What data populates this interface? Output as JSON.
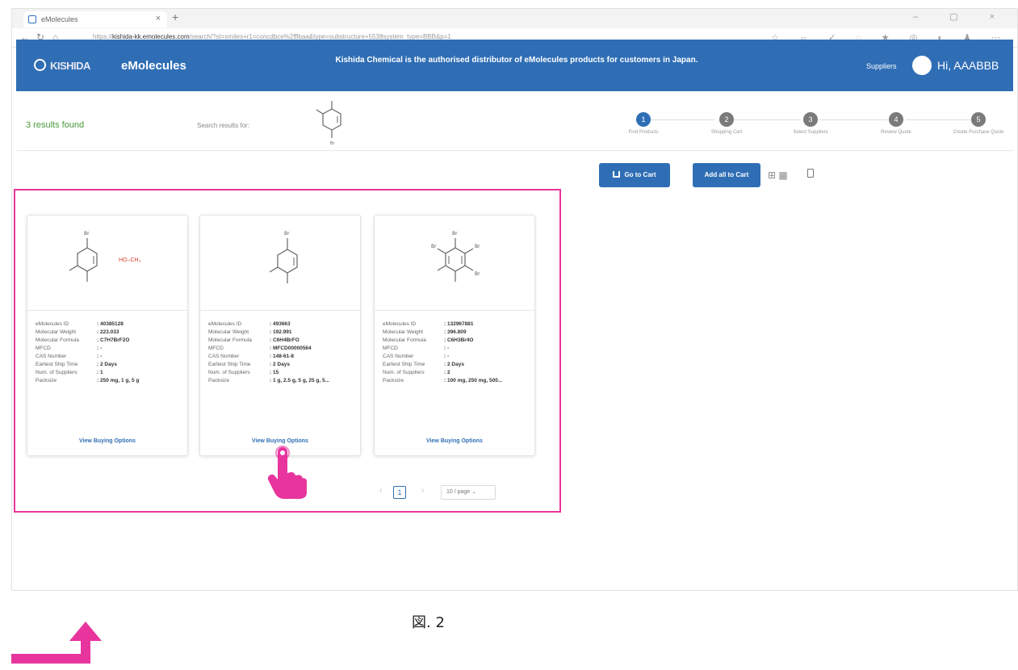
{
  "browser": {
    "tab_title": "eMolecules",
    "tab_close": "×",
    "new_tab": "+",
    "window_controls": "– ▢ ×",
    "nav": {
      "back": "←",
      "refresh": "↻",
      "home": "⌂"
    },
    "url_prefix": "https://",
    "url_host": "kishida-kk.emolecules.com",
    "url_path": "/search/?st=smiles+r1=concdbce%2fflbaa&type=substructure+5538system_type=BBB&p=1",
    "toolbar_icons": "☆ ⇔ ✓ ◌ ★ ◎ ◐ ♟ ⋯"
  },
  "header": {
    "logo_text": "KISHIDA",
    "brand": "eMolecules",
    "banner": "Kishida Chemical is the authorised distributor of eMolecules products for customers in Japan.",
    "suppliers_link": "Suppliers",
    "greeting": "Hi, AAABBB"
  },
  "summary": {
    "results_found": "3 results found",
    "search_label": "Search results for:"
  },
  "stepper": [
    {
      "number": "1",
      "label": "Find Products",
      "active": true
    },
    {
      "number": "2",
      "label": "Shopping Cart",
      "active": false
    },
    {
      "number": "3",
      "label": "Select Suppliers",
      "active": false
    },
    {
      "number": "4",
      "label": "Review Quote",
      "active": false
    },
    {
      "number": "5",
      "label": "Create Purchase Quote",
      "active": false
    }
  ],
  "toolbar": {
    "go_to_cart": "Go to Cart",
    "add_all_to_cart": "Add all to Cart",
    "grid_view": "⊞ ▦"
  },
  "spec_labels": [
    "eMolecules ID",
    "Molecular Weight",
    "Molecular Formula",
    "MFCD",
    "CAS Number",
    "Earliest Ship Time",
    "Num. of Suppliers",
    "Packsize"
  ],
  "cards": [
    {
      "values": [
        ": 40385128",
        ": 223.033",
        ": C7H7BrF2O",
        ": -",
        ": -",
        ": 2 Days",
        ": 1",
        ": 250 mg, 1 g, 5 g"
      ],
      "view_options": "View Buying Options",
      "image_label": "HO–CH₃"
    },
    {
      "values": [
        ": 493663",
        ": 192.991",
        ": C6H4BrFO",
        ": MFCD00000564",
        ": 148-61-8",
        ": 2 Days",
        ": 15",
        ": 1 g, 2.5 g, 5 g, 25 g, 5..."
      ],
      "view_options": "View Buying Options"
    },
    {
      "values": [
        ": 132967881",
        ": 396.809",
        ": C6H3Br4O",
        ": -",
        ": -",
        ": 2 Days",
        ": 2",
        ": 100 mg, 250 mg, 500..."
      ],
      "view_options": "View Buying Options"
    }
  ],
  "pagination": {
    "prev": "‹",
    "current": "1",
    "next": "›",
    "page_size": "10 / page ⌄"
  },
  "figure_caption": "図. 2",
  "colors": {
    "header_blue": "#2f6eb5",
    "highlight_magenta": "#e8359e",
    "success_green": "#4a9a3a"
  }
}
